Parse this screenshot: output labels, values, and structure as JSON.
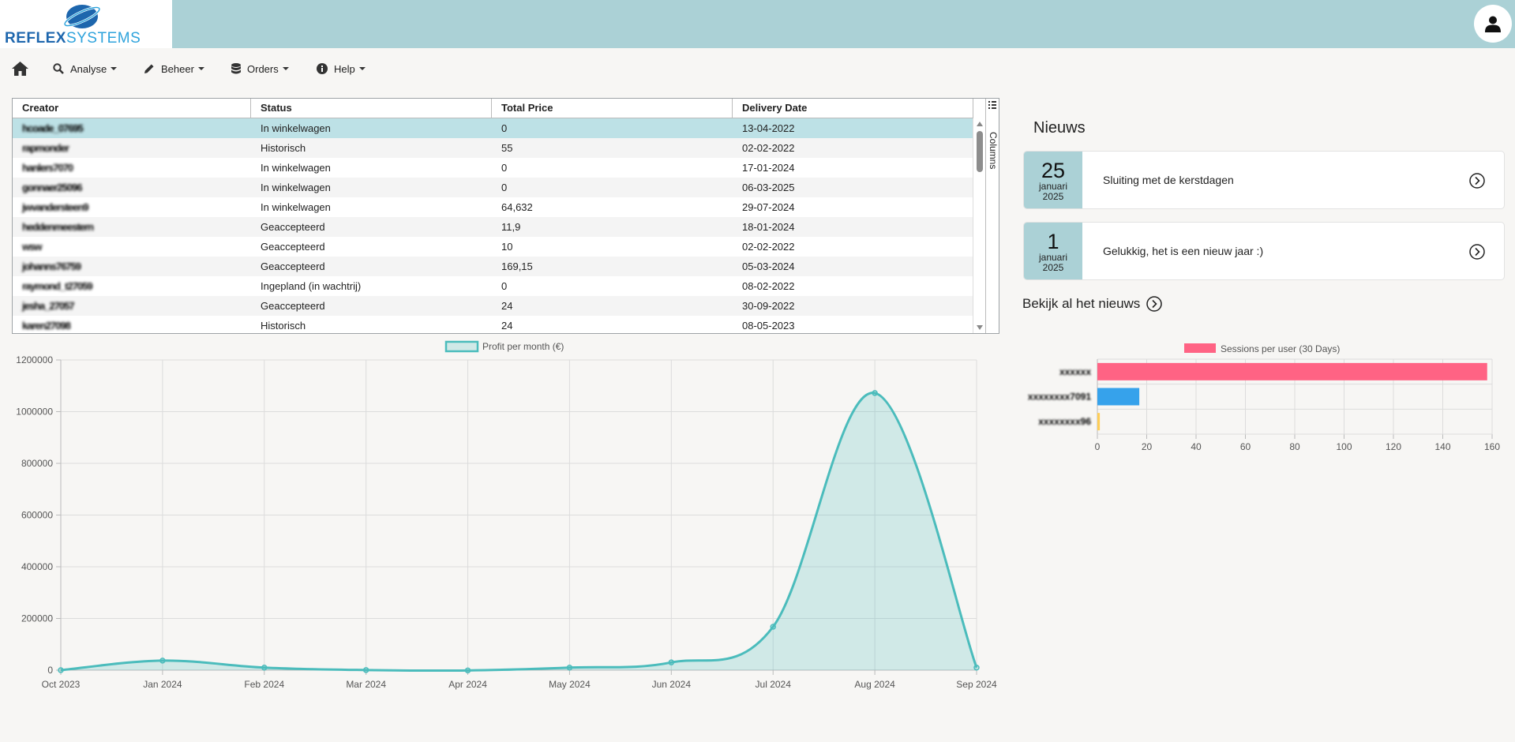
{
  "header": {
    "logo_text_bold": "REFLEX",
    "logo_text_light": "SYSTEMS",
    "user_icon": "user-icon"
  },
  "nav": {
    "home_icon": "home-icon",
    "items": [
      {
        "label": "Analyse",
        "icon": "magnifier-icon"
      },
      {
        "label": "Beheer",
        "icon": "pencil-icon"
      },
      {
        "label": "Orders",
        "icon": "database-icon"
      },
      {
        "label": "Help",
        "icon": "info-icon"
      }
    ]
  },
  "table": {
    "columns": [
      "Creator",
      "Status",
      "Total Price",
      "Delivery Date"
    ],
    "side_panel_label": "Columns",
    "rows": [
      {
        "creator": "hcoade_07695",
        "status": "In winkelwagen",
        "total_price": "0",
        "delivery_date": "13-04-2022",
        "selected": true
      },
      {
        "creator": "rapmonder",
        "status": "Historisch",
        "total_price": "55",
        "delivery_date": "02-02-2022"
      },
      {
        "creator": "hanlers7070",
        "status": "In winkelwagen",
        "total_price": "0",
        "delivery_date": "17-01-2024"
      },
      {
        "creator": "gonnaer25096",
        "status": "In winkelwagen",
        "total_price": "0",
        "delivery_date": "06-03-2025"
      },
      {
        "creator": "jwvandersteen9",
        "status": "In winkelwagen",
        "total_price": "64,632",
        "delivery_date": "29-07-2024"
      },
      {
        "creator": "heddenmeestern",
        "status": "Geaccepteerd",
        "total_price": "11,9",
        "delivery_date": "18-01-2024"
      },
      {
        "creator": "wsw",
        "status": "Geaccepteerd",
        "total_price": "10",
        "delivery_date": "02-02-2022"
      },
      {
        "creator": "johanns76759",
        "status": "Geaccepteerd",
        "total_price": "169,15",
        "delivery_date": "05-03-2024"
      },
      {
        "creator": "raymond_t27059",
        "status": "Ingepland (in wachtrij)",
        "total_price": "0",
        "delivery_date": "08-02-2022"
      },
      {
        "creator": "jesha_27057",
        "status": "Geaccepteerd",
        "total_price": "24",
        "delivery_date": "30-09-2022"
      },
      {
        "creator": "karen27098",
        "status": "Historisch",
        "total_price": "24",
        "delivery_date": "08-05-2023"
      }
    ]
  },
  "news": {
    "title": "Nieuws",
    "items": [
      {
        "day": "25",
        "month": "januari",
        "year": "2025",
        "text": "Sluiting met de kerstdagen"
      },
      {
        "day": "1",
        "month": "januari",
        "year": "2025",
        "text": "Gelukkig, het is een nieuw jaar :)"
      }
    ],
    "all_link": "Bekijk al het nieuws"
  },
  "chart_data": [
    {
      "type": "area",
      "legend": "Profit per month (€)",
      "categories": [
        "Oct 2023",
        "Jan 2024",
        "Feb 2024",
        "Mar 2024",
        "Apr 2024",
        "May 2024",
        "Jun 2024",
        "Jul 2024",
        "Aug 2024",
        "Sep 2024"
      ],
      "values": [
        0,
        37000,
        10000,
        500,
        -1000,
        10000,
        30000,
        168000,
        1072000,
        10000
      ],
      "ylim": [
        0,
        1200000
      ],
      "yticks": [
        0,
        200000,
        400000,
        600000,
        800000,
        1000000,
        1200000
      ],
      "color": "#4bbcbc",
      "fill": "rgba(75,188,188,0.22)",
      "grid": true,
      "legend_position": "top"
    },
    {
      "type": "bar",
      "orientation": "horizontal",
      "legend": "Sessions per user (30 Days)",
      "categories": [
        "xxxxxx",
        "xxxxxxxx7091",
        "xxxxxxxx96"
      ],
      "values": [
        158,
        17,
        1
      ],
      "colors": [
        "#ff6384",
        "#36a2eb",
        "#ffce56"
      ],
      "xlim": [
        0,
        160
      ],
      "xticks": [
        0,
        20,
        40,
        60,
        80,
        100,
        120,
        140,
        160
      ],
      "grid": true,
      "legend_position": "top"
    }
  ]
}
